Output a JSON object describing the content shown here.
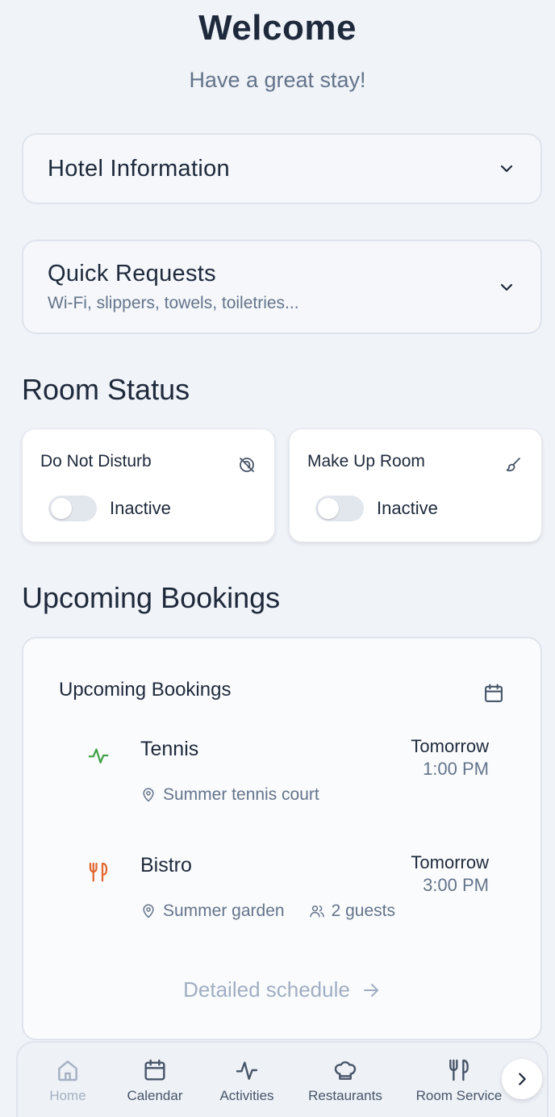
{
  "header": {
    "title": "Welcome",
    "subtitle": "Have a great stay!"
  },
  "hotel_info": {
    "title": "Hotel Information",
    "icon": "chevron-down-icon"
  },
  "quick_requests": {
    "title": "Quick Requests",
    "subtitle": "Wi-Fi, slippers, towels, toiletries..."
  },
  "room_status": {
    "title": "Room Status",
    "cards": [
      {
        "label": "Do Not Disturb",
        "state": "Inactive",
        "icon": "bell-off-icon",
        "enabled": false
      },
      {
        "label": "Make Up Room",
        "state": "Inactive",
        "icon": "brush-icon",
        "enabled": false
      }
    ]
  },
  "bookings_section": {
    "title": "Upcoming Bookings"
  },
  "bookings_card": {
    "title": "Upcoming Bookings",
    "items": [
      {
        "name": "Tennis",
        "day": "Tomorrow",
        "time": "1:00 PM",
        "location": "Summer tennis court",
        "icon": "activity-icon",
        "icon_color": "#43a047"
      },
      {
        "name": "Bistro",
        "day": "Tomorrow",
        "time": "3:00 PM",
        "location": "Summer garden",
        "guests": "2 guests",
        "icon": "utensils-icon",
        "icon_color": "#e2662d"
      }
    ],
    "detail_link": "Detailed schedule"
  },
  "nav": {
    "items": [
      {
        "label": "Home",
        "icon": "home-icon",
        "active": true
      },
      {
        "label": "Calendar",
        "icon": "calendar-icon"
      },
      {
        "label": "Activities",
        "icon": "activity-icon"
      },
      {
        "label": "Restaurants",
        "icon": "chef-hat-icon"
      },
      {
        "label": "Room Service",
        "icon": "utensils-icon"
      }
    ],
    "next_icon": "chevron-right-icon"
  }
}
